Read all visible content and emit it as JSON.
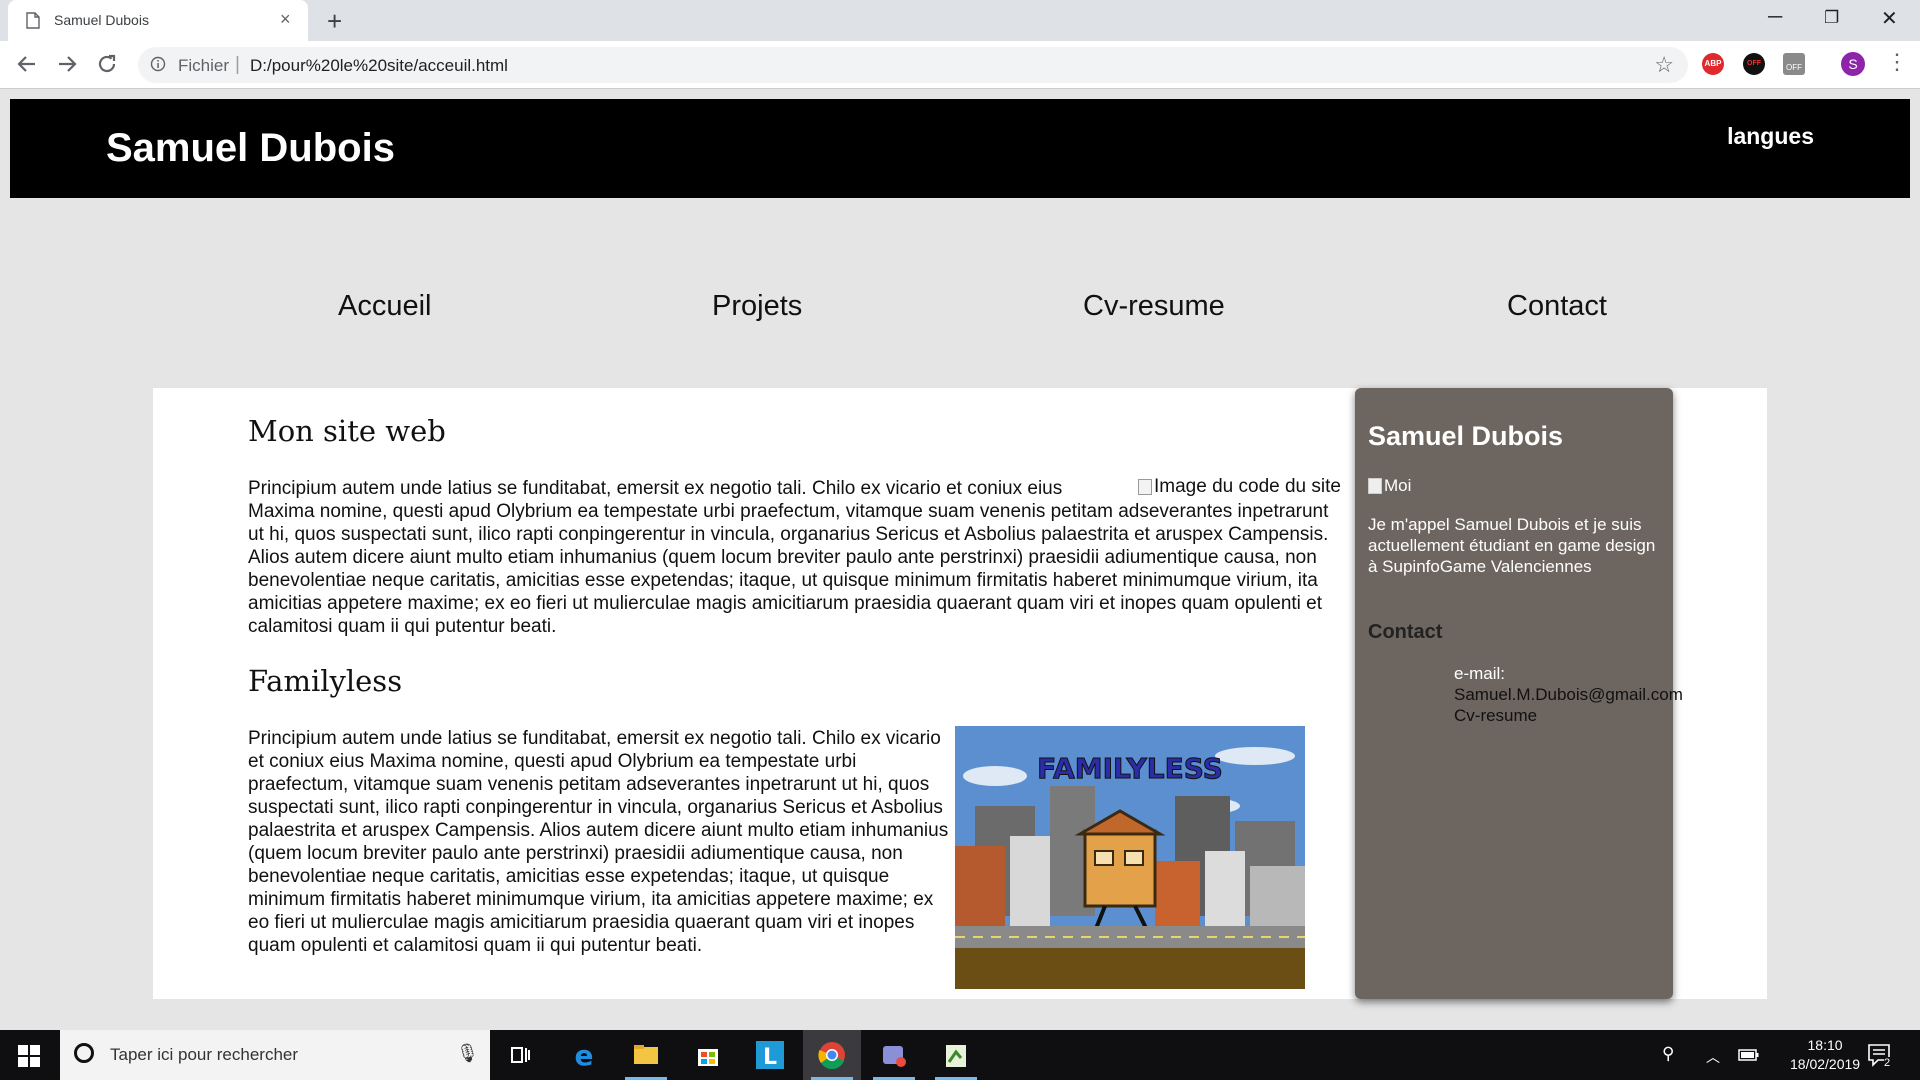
{
  "browser": {
    "tab_title": "Samuel Dubois",
    "tab_close": "×",
    "new_tab": "+",
    "scheme_label": "Fichier",
    "separator": "|",
    "url": "D:/pour%20le%20site/acceuil.html",
    "window_controls": {
      "minimize": "─",
      "maximize": "❐",
      "close": "✕"
    },
    "extensions": [
      {
        "name": "adblock-plus-icon",
        "label": "ABP",
        "color": "#e0292c"
      },
      {
        "name": "stopper-extension-icon",
        "label": "OFF",
        "color": "#111111"
      },
      {
        "name": "off-toggle-extension-icon",
        "label": "OFF",
        "color": "#8a8a8a"
      },
      {
        "name": "profile-avatar",
        "label": "S",
        "color": "#8e24aa"
      }
    ]
  },
  "site": {
    "brand": "Samuel Dubois",
    "languages_link": "langues",
    "nav": [
      "Accueil",
      "Projets",
      "Cv-resume",
      "Contact"
    ],
    "section1": {
      "title": "Mon site web",
      "text": "Principium autem unde latius se funditabat, emersit ex negotio tali. Chilo ex vicario et coniux eius Maxima nomine, questi apud Olybrium ea tempestate urbi praefectum, vitamque suam venenis petitam adseverantes inpetrarunt ut hi, quos suspectati sunt, ilico rapti conpingerentur in vincula, organarius Sericus et Asbolius palaestrita et aruspex Campensis. Alios autem dicere aiunt multo etiam inhumanius (quem locum breviter paulo ante perstrinxi) praesidii adiumentique causa, non benevolentiae neque caritatis, amicitias esse expetendas; itaque, ut quisque minimum firmitatis haberet minimumque virium, ita amicitias appetere maxime; ex eo fieri ut mulierculae magis amicitiarum praesidia quaerant quam viri et inopes quam opulenti et calamitosi quam ii qui putentur beati.",
      "image_alt": "Image du code du site"
    },
    "section2": {
      "title": "Familyless",
      "text": "Principium autem unde latius se funditabat, emersit ex negotio tali. Chilo ex vicario et coniux eius Maxima nomine, questi apud Olybrium ea tempestate urbi praefectum, vitamque suam venenis petitam adseverantes inpetrarunt ut hi, quos suspectati sunt, ilico rapti conpingerentur in vincula, organarius Sericus et Asbolius palaestrita et aruspex Campensis. Alios autem dicere aiunt multo etiam inhumanius (quem locum breviter paulo ante perstrinxi) praesidii adiumentique causa, non benevolentiae neque caritatis, amicitias esse expetendas; itaque, ut quisque minimum firmitatis haberet minimumque virium, ita amicitias appetere maxime; ex eo fieri ut mulierculae magis amicitiarum praesidia quaerant quam viri et inopes quam opulenti et calamitosi quam ii qui putentur beati.",
      "game_logo": "FAMILYLESS"
    },
    "sidebar": {
      "name": "Samuel Dubois",
      "photo_alt": "Moi",
      "bio": "Je m'appel Samuel Dubois et je suis actuellement étudiant en game design à SupinfoGame Valenciennes",
      "contact_title": "Contact",
      "email_label": "e-mail:",
      "email": "Samuel.M.Dubois@gmail.com",
      "cv_link": "Cv-resume"
    },
    "colors": {
      "header_bg": "#000000",
      "page_bg": "#e5e5e5",
      "sidebar_bg": "#6d6660"
    }
  },
  "taskbar": {
    "search_placeholder": "Taper ici pour rechercher",
    "apps": [
      "task-view-icon",
      "edge-icon",
      "file-explorer-icon",
      "store-icon",
      "l-app-icon",
      "chrome-icon",
      "media-app-icon",
      "notepad-app-icon"
    ],
    "time": "18:10",
    "date": "18/02/2019",
    "notifications": "2"
  }
}
